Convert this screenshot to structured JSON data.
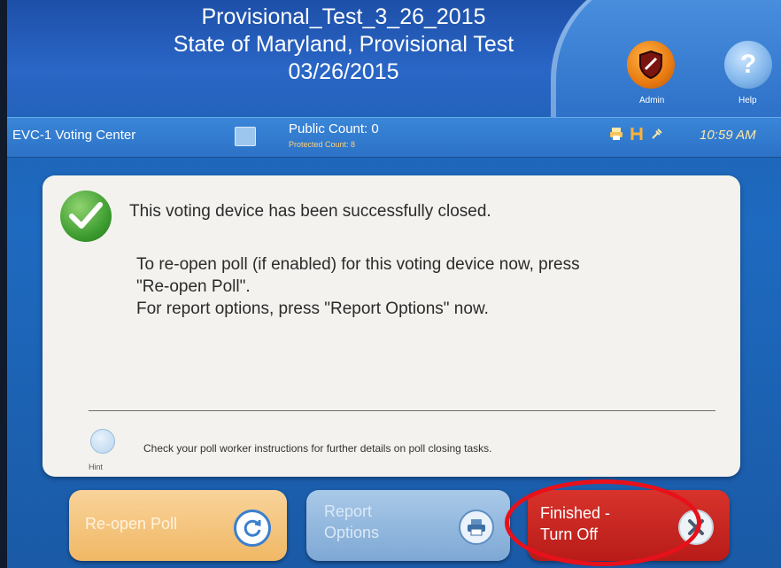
{
  "header": {
    "title_line1": "Provisional_Test_3_26_2015",
    "title_line2": "State of Maryland, Provisional Test",
    "title_line3": "03/26/2015",
    "admin_label": "Admin",
    "help_label": "Help",
    "help_glyph": "?"
  },
  "status_bar": {
    "center_name": "EVC-1 Voting Center",
    "public_count": "Public Count: 0",
    "protected_count": "Protected Count: 8",
    "time": "10:59 AM",
    "icons": [
      "printer-icon",
      "h-icon",
      "power-plug-icon"
    ]
  },
  "message": {
    "main": "This voting device has been successfully closed.",
    "line1": "To re-open poll (if enabled) for this voting device now, press",
    "line2": "\"Re-open Poll\".",
    "line3": "For report options, press \"Report Options\" now."
  },
  "hint": {
    "label": "Hint",
    "text": "Check your poll worker instructions for further details on poll closing tasks."
  },
  "buttons": {
    "reopen": "Re-open Poll",
    "report_line1": "Report",
    "report_line2": "Options",
    "finished_line1": "Finished -",
    "finished_line2": "Turn Off"
  },
  "colors": {
    "finished_button": "#c0231e",
    "highlight_ellipse": "#e8101a",
    "reopen_button": "#f0b865",
    "report_button": "#7ea8d4"
  }
}
